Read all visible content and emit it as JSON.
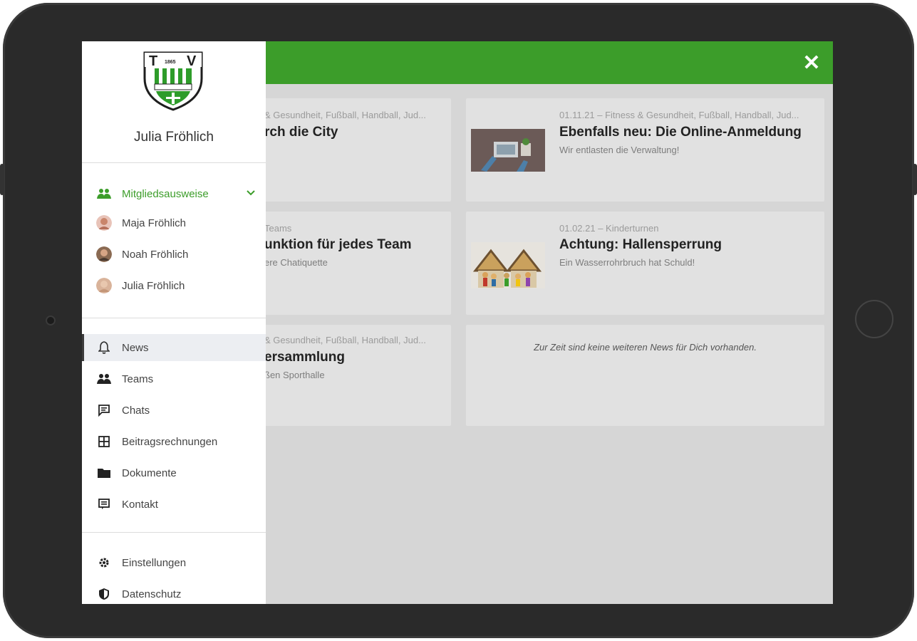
{
  "user": {
    "name": "Julia Fröhlich"
  },
  "members_section": {
    "label": "Mitgliedsausweise",
    "members": [
      {
        "name": "Maja Fröhlich"
      },
      {
        "name": "Noah Fröhlich"
      },
      {
        "name": "Julia Fröhlich"
      }
    ]
  },
  "nav": [
    {
      "label": "News",
      "icon": "bell-icon",
      "active": true
    },
    {
      "label": "Teams",
      "icon": "people-icon"
    },
    {
      "label": "Chats",
      "icon": "chat-icon"
    },
    {
      "label": "Beitragsrechnungen",
      "icon": "invoice-icon"
    },
    {
      "label": "Dokumente",
      "icon": "folder-icon"
    },
    {
      "label": "Kontakt",
      "icon": "contact-icon"
    }
  ],
  "footer_nav": [
    {
      "label": "Einstellungen",
      "icon": "gear-icon"
    },
    {
      "label": "Datenschutz",
      "icon": "shield-icon"
    }
  ],
  "news": [
    {
      "meta": "& Gesundheit, Fußball, Handball, Jud...",
      "title": "rch die City",
      "sub": ""
    },
    {
      "meta": "01.11.21 – Fitness & Gesundheit, Fußball, Handball, Jud...",
      "title": "Ebenfalls neu: Die Online-Anmeldung",
      "sub": "Wir entlasten die Verwaltung!"
    },
    {
      "meta": "Teams",
      "title": "unktion für jedes Team",
      "sub": "ere Chatiquette"
    },
    {
      "meta": "01.02.21 – Kinderturnen",
      "title": "Achtung: Hallensperrung",
      "sub": "Ein Wasserrohrbruch hat Schuld!"
    },
    {
      "meta": "& Gesundheit, Fußball, Handball, Jud...",
      "title": "ersammlung",
      "sub": "ßen Sporthalle"
    }
  ],
  "empty_message": "Zur Zeit sind keine weiteren News für Dich vorhanden.",
  "colors": {
    "brand": "#3c9d2a",
    "drawer_bg": "#ffffff",
    "overlay": "#d6d6d6"
  }
}
